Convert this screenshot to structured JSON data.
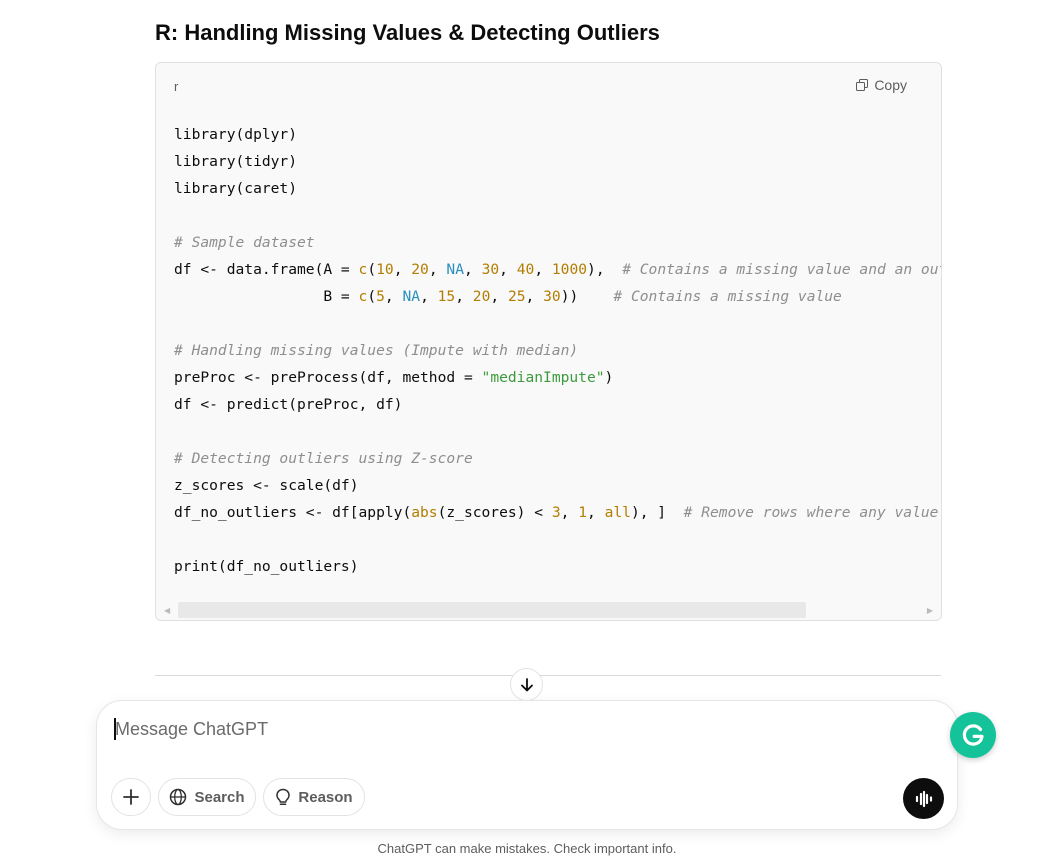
{
  "section": {
    "heading": "R: Handling Missing Values & Detecting Outliers"
  },
  "code_block": {
    "language": "r",
    "copy_label": "Copy",
    "lines": [
      [
        {
          "t": "library(dplyr)",
          "c": ""
        }
      ],
      [
        {
          "t": "library(tidyr)",
          "c": ""
        }
      ],
      [
        {
          "t": "library(caret)",
          "c": ""
        }
      ],
      [],
      [
        {
          "t": "# Sample dataset",
          "c": "comment"
        }
      ],
      [
        {
          "t": "df <- data.frame(A = ",
          "c": ""
        },
        {
          "t": "c",
          "c": "fn"
        },
        {
          "t": "(",
          "c": ""
        },
        {
          "t": "10",
          "c": "num"
        },
        {
          "t": ", ",
          "c": ""
        },
        {
          "t": "20",
          "c": "num"
        },
        {
          "t": ", ",
          "c": ""
        },
        {
          "t": "NA",
          "c": "na"
        },
        {
          "t": ", ",
          "c": ""
        },
        {
          "t": "30",
          "c": "num"
        },
        {
          "t": ", ",
          "c": ""
        },
        {
          "t": "40",
          "c": "num"
        },
        {
          "t": ", ",
          "c": ""
        },
        {
          "t": "1000",
          "c": "num"
        },
        {
          "t": "),  ",
          "c": ""
        },
        {
          "t": "# Contains a missing value and an outl",
          "c": "comment"
        }
      ],
      [
        {
          "t": "                 B = ",
          "c": ""
        },
        {
          "t": "c",
          "c": "fn"
        },
        {
          "t": "(",
          "c": ""
        },
        {
          "t": "5",
          "c": "num"
        },
        {
          "t": ", ",
          "c": ""
        },
        {
          "t": "NA",
          "c": "na"
        },
        {
          "t": ", ",
          "c": ""
        },
        {
          "t": "15",
          "c": "num"
        },
        {
          "t": ", ",
          "c": ""
        },
        {
          "t": "20",
          "c": "num"
        },
        {
          "t": ", ",
          "c": ""
        },
        {
          "t": "25",
          "c": "num"
        },
        {
          "t": ", ",
          "c": ""
        },
        {
          "t": "30",
          "c": "num"
        },
        {
          "t": "))    ",
          "c": ""
        },
        {
          "t": "# Contains a missing value",
          "c": "comment"
        }
      ],
      [],
      [
        {
          "t": "# Handling missing values (Impute with median)",
          "c": "comment"
        }
      ],
      [
        {
          "t": "preProc <- preProcess(df, method = ",
          "c": ""
        },
        {
          "t": "\"medianImpute\"",
          "c": "str"
        },
        {
          "t": ")",
          "c": ""
        }
      ],
      [
        {
          "t": "df <- predict(preProc, df)",
          "c": ""
        }
      ],
      [],
      [
        {
          "t": "# Detecting outliers using Z-score",
          "c": "comment"
        }
      ],
      [
        {
          "t": "z_scores <- scale(df)",
          "c": ""
        }
      ],
      [
        {
          "t": "df_no_outliers <- df[apply(",
          "c": ""
        },
        {
          "t": "abs",
          "c": "fn"
        },
        {
          "t": "(z_scores) < ",
          "c": ""
        },
        {
          "t": "3",
          "c": "num"
        },
        {
          "t": ", ",
          "c": ""
        },
        {
          "t": "1",
          "c": "num"
        },
        {
          "t": ", ",
          "c": ""
        },
        {
          "t": "all",
          "c": "fn"
        },
        {
          "t": "), ]  ",
          "c": ""
        },
        {
          "t": "# Remove rows where any value h",
          "c": "comment"
        }
      ],
      [],
      [
        {
          "t": "print(df_no_outliers)",
          "c": ""
        }
      ]
    ]
  },
  "composer": {
    "placeholder": "Message ChatGPT",
    "search_label": "Search",
    "reason_label": "Reason"
  },
  "footer": {
    "disclaimer": "ChatGPT can make mistakes. Check important info."
  },
  "icons": {
    "copy": "copy-icon",
    "scroll_down": "arrow-down-icon",
    "add": "plus-icon",
    "search": "globe-icon",
    "reason": "lightbulb-icon",
    "voice": "voice-waveform-icon",
    "grammarly": "grammarly-icon"
  },
  "colors": {
    "comment": "#8e8e8e",
    "number": "#b27d00",
    "na": "#2a8fbd",
    "string": "#3d9a3d",
    "grammarly": "#15c39a"
  }
}
